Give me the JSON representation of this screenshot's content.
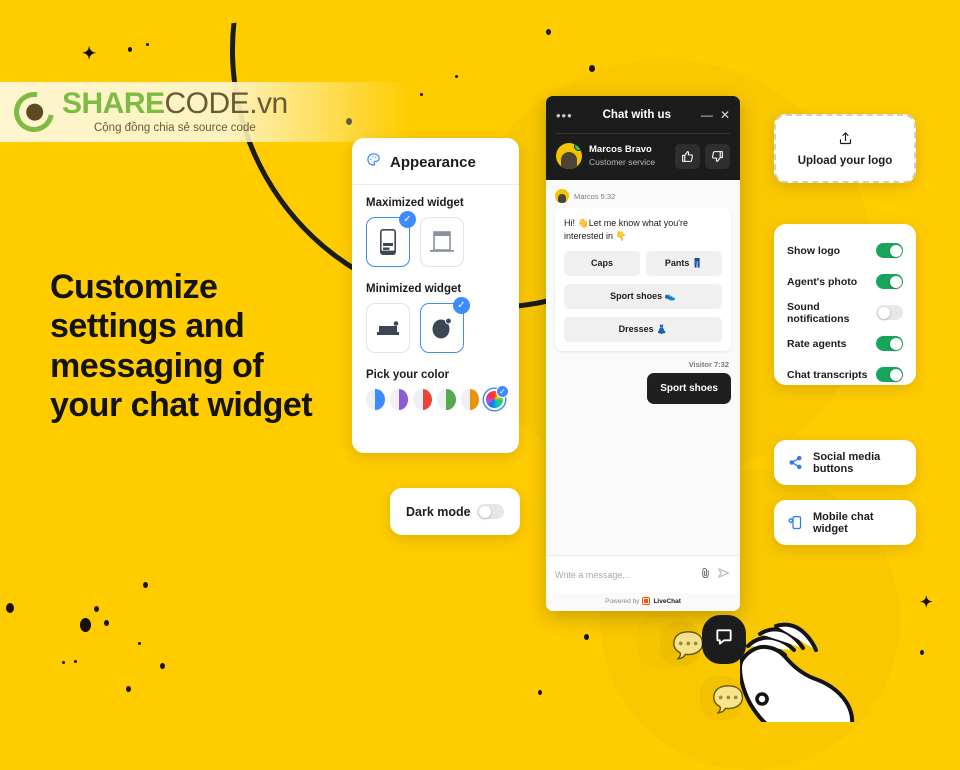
{
  "theme": {
    "background": "#FFCC00",
    "accent_blue": "#3E8BFF",
    "toggle_on": "#18A55B",
    "dark": "#1C1C1C"
  },
  "watermark": {
    "brand_green": "SHARE",
    "brand_dark": "CODE.vn",
    "tagline": "Cộng đồng chia sẻ source code",
    "logo_icon": "recycle-logo-icon"
  },
  "headline": "Customize settings and messaging of your chat widget",
  "appearance": {
    "title": "Appearance",
    "title_icon": "palette-icon",
    "maximized": {
      "label": "Maximized widget",
      "options": [
        {
          "name": "mobile-widget-icon",
          "selected": true
        },
        {
          "name": "window-widget-icon",
          "selected": false
        }
      ]
    },
    "minimized": {
      "label": "Minimized widget",
      "options": [
        {
          "name": "bar-minimized-icon",
          "selected": false
        },
        {
          "name": "bubble-minimized-icon",
          "selected": true
        }
      ]
    },
    "color": {
      "label": "Pick your color",
      "swatches": [
        {
          "name": "blue",
          "hex": "#3E8BFF",
          "selected": false
        },
        {
          "name": "purple",
          "hex": "#8E5BD4",
          "selected": false
        },
        {
          "name": "red",
          "hex": "#E8453C",
          "selected": false
        },
        {
          "name": "green",
          "hex": "#54A951",
          "selected": false
        },
        {
          "name": "orange",
          "hex": "#E8930C",
          "selected": false
        },
        {
          "name": "custom",
          "hex": "rainbow",
          "selected": true
        }
      ]
    },
    "check_glyph": "✓"
  },
  "dark_mode": {
    "label": "Dark mode",
    "enabled": false
  },
  "chat_widget": {
    "header": {
      "menu_icon": "•••",
      "title": "Chat with us",
      "minimize_glyph": "—",
      "close_glyph": "✕"
    },
    "agent": {
      "name": "Marcos Bravo",
      "role": "Customer service",
      "status": "online",
      "thumbs_up_glyph": "👍",
      "thumbs_down_glyph": "👎"
    },
    "messages": [
      {
        "meta": "Marcos 5:32",
        "side": "in",
        "text": "Hi! 👋Let me know what you're interested in 👇"
      },
      {
        "meta": "Visitor 7:32",
        "side": "out",
        "text": "Sport shoes"
      }
    ],
    "quick_replies": [
      "Caps",
      "Pants 👖",
      "Sport shoes 👟",
      "Dresses 👗"
    ],
    "composer": {
      "placeholder": "Write a message...",
      "attach_icon": "paperclip-icon",
      "send_icon": "send-arrow-icon"
    },
    "footer": {
      "powered_by": "Powered by",
      "brand": "LiveChat"
    }
  },
  "upload": {
    "label": "Upload your  logo",
    "icon": "upload-icon"
  },
  "settings": {
    "rows": [
      {
        "label": "Show logo",
        "enabled": true
      },
      {
        "label": "Agent's photo",
        "enabled": true
      },
      {
        "label": "Sound notifications",
        "enabled": false
      },
      {
        "label": "Rate agents",
        "enabled": true
      },
      {
        "label": "Chat transcripts",
        "enabled": true
      }
    ]
  },
  "actions": [
    {
      "label": "Social media buttons",
      "icon": "share-icon"
    },
    {
      "label": "Mobile chat widget",
      "icon": "mobile-settings-icon"
    }
  ],
  "launcher": {
    "icon": "chat-bubble-icon",
    "cursor": "pointing-hand-icon"
  }
}
